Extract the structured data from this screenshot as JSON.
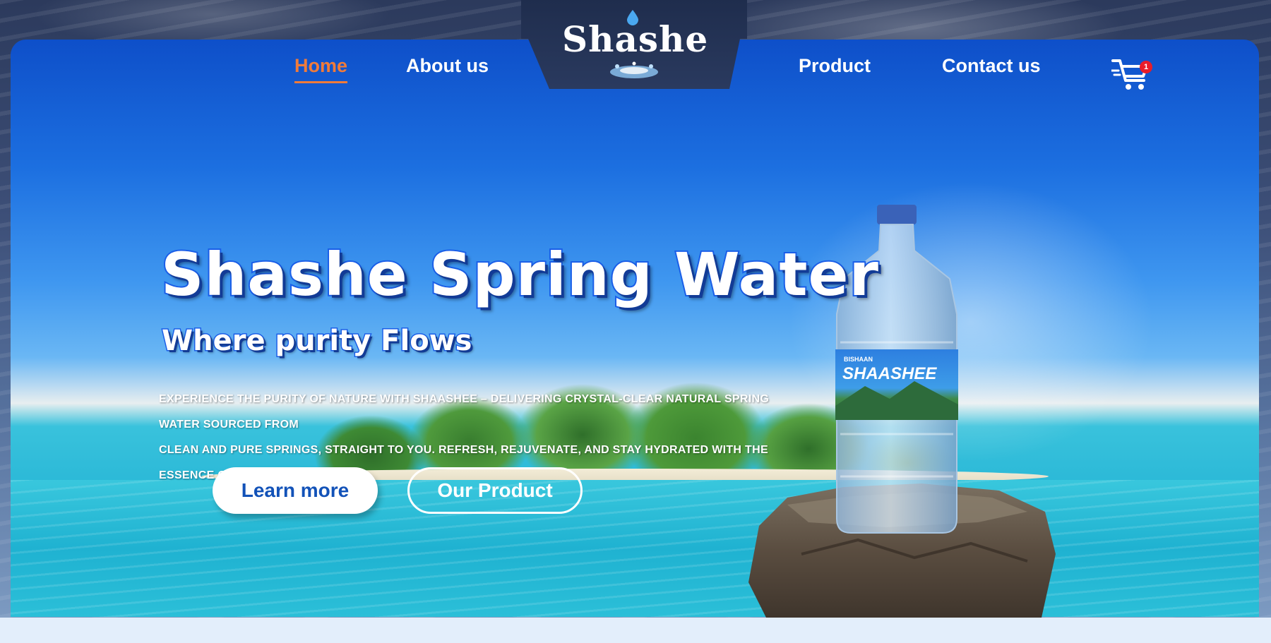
{
  "brand": {
    "logo_text": "Shashe"
  },
  "nav": {
    "items": [
      {
        "label": "Home",
        "active": true
      },
      {
        "label": "About us",
        "active": false
      },
      {
        "label": "Product",
        "active": false
      },
      {
        "label": "Contact us",
        "active": false
      }
    ],
    "cart_count": "1"
  },
  "hero": {
    "title": "Shashe Spring Water",
    "subtitle": "Where purity Flows",
    "description_line1": "EXPERIENCE THE PURITY OF NATURE WITH SHAASHEE – DELIVERING CRYSTAL-CLEAR NATURAL SPRING WATER SOURCED FROM",
    "description_line2": "CLEAN AND PURE SPRINGS, STRAIGHT TO YOU. REFRESH, REJUVENATE, AND STAY HYDRATED WITH THE ESSENCE OF LIFE",
    "primary_button": "Learn more",
    "secondary_button": "Our Product"
  },
  "product": {
    "label_brand_small": "BISHAAN",
    "label_brand": "SHAASHEE"
  },
  "colors": {
    "accent": "#f07b3a",
    "brand_blue": "#1a5ee8",
    "badge": "#e81d2a"
  },
  "icons": {
    "cart": "shopping-cart-icon",
    "drop": "water-drop-icon"
  }
}
